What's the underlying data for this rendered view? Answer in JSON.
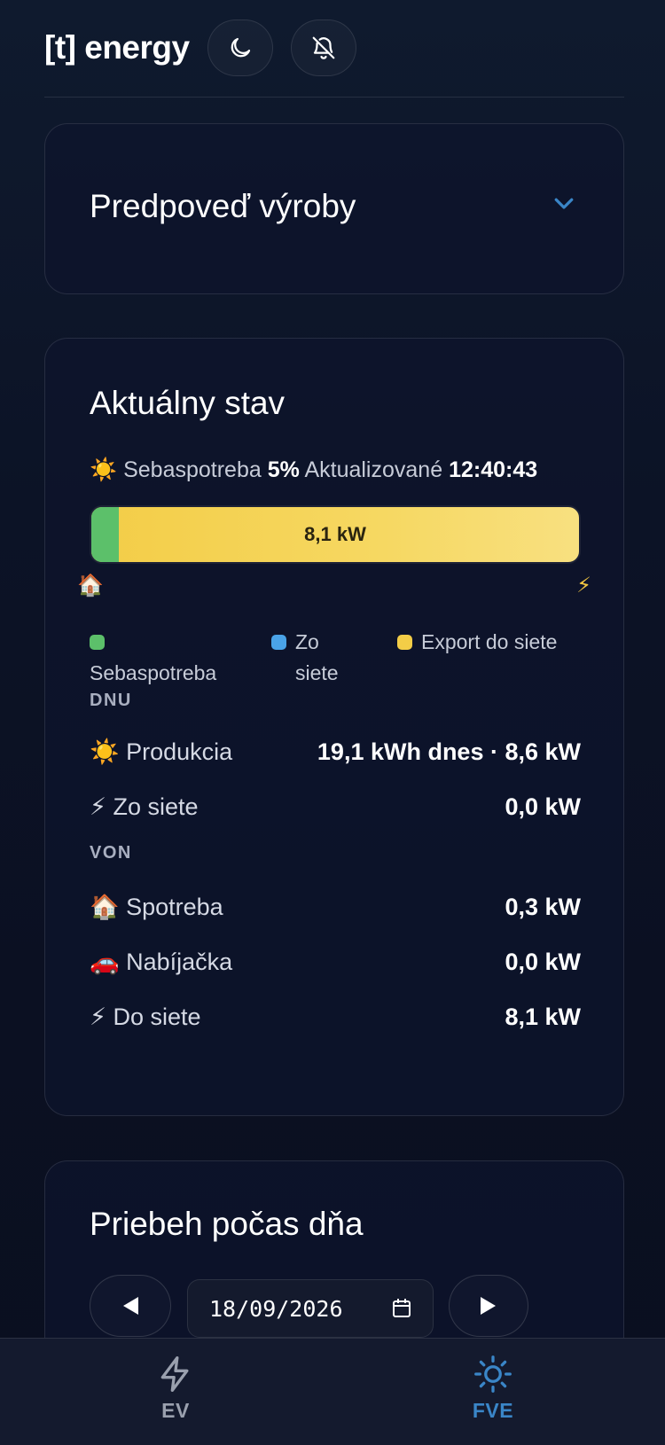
{
  "header": {
    "brand": "[t] energy",
    "icons": [
      "moon-icon",
      "bell-off-icon"
    ]
  },
  "forecast": {
    "title": "Predpoveď výroby",
    "icon": "chevron-down-icon"
  },
  "status": {
    "title": "Aktuálny stav",
    "sun_emoji": "☀️",
    "self_label": "Sebaspotreba",
    "self_pct": "5%",
    "updated_label": "Aktualizované",
    "updated_time": "12:40:43",
    "bar": {
      "label": "8,1 kW",
      "self_fraction": 0.05
    },
    "house_emoji": "🏠",
    "bolt_emoji": "⚡",
    "legend": [
      {
        "label": "Sebaspotreba",
        "color": "#5cc06a"
      },
      {
        "label": "Zo siete",
        "color": "#4aa3e8"
      },
      {
        "label": "Export do siete",
        "color": "#f3cd47"
      }
    ],
    "in_label": "DNU",
    "in_rows": [
      {
        "label": "☀️ Produkcia",
        "value": "19,1 kWh dnes · 8,6 kW"
      },
      {
        "label": "⚡ Zo siete",
        "value": "0,0 kW"
      }
    ],
    "out_label": "VON",
    "out_rows": [
      {
        "label": "🏠 Spotreba",
        "value": "0,3 kW"
      },
      {
        "label": "🚗 Nabíjačka",
        "value": "0,0 kW"
      },
      {
        "label": "⚡ Do siete",
        "value": "8,1 kW"
      }
    ]
  },
  "day": {
    "title": "Priebeh počas dňa",
    "date": "18/09/2026",
    "icons": [
      "prev-icon",
      "calendar-icon",
      "next-icon"
    ]
  },
  "bottom_nav": {
    "tabs": [
      {
        "label": "EV",
        "icon": "lightning-icon",
        "color": "#9aa0ae"
      },
      {
        "label": "FVE",
        "icon": "sun-icon",
        "color": "#3a86c8"
      }
    ]
  }
}
